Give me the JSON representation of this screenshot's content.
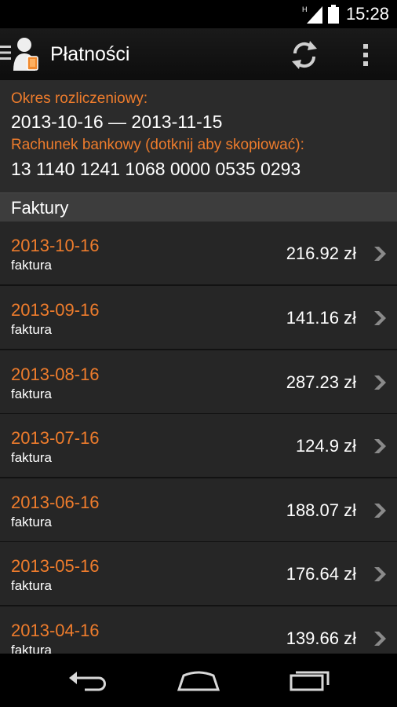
{
  "status_bar": {
    "network_type": "H",
    "time": "15:28",
    "icons": [
      "signal-icon",
      "battery-icon"
    ]
  },
  "action_bar": {
    "title": "Płatności",
    "icons": [
      "drawer-icon",
      "app-logo-icon",
      "refresh-icon",
      "overflow-menu-icon"
    ]
  },
  "billing": {
    "period_label": "Okres rozliczeniowy:",
    "period_value": "2013-10-16 — 2013-11-15",
    "account_label": "Rachunek bankowy (dotknij aby skopiować):",
    "account_value": "13 1140 1241 1068 0000 0535 0293"
  },
  "section": {
    "title": "Faktury"
  },
  "invoices": [
    {
      "date": "2013-10-16",
      "type": "faktura",
      "amount": "216.92 zł"
    },
    {
      "date": "2013-09-16",
      "type": "faktura",
      "amount": "141.16 zł"
    },
    {
      "date": "2013-08-16",
      "type": "faktura",
      "amount": "287.23 zł"
    },
    {
      "date": "2013-07-16",
      "type": "faktura",
      "amount": "124.9 zł"
    },
    {
      "date": "2013-06-16",
      "type": "faktura",
      "amount": "188.07 zł"
    },
    {
      "date": "2013-05-16",
      "type": "faktura",
      "amount": "176.64 zł"
    },
    {
      "date": "2013-04-16",
      "type": "faktura",
      "amount": "139.66 zł"
    }
  ],
  "nav_bar": {
    "icons": [
      "back-icon",
      "home-icon",
      "recents-icon"
    ]
  },
  "colors": {
    "accent": "#ee7c2c",
    "background": "#262626",
    "section_header": "#3d3d3d"
  }
}
